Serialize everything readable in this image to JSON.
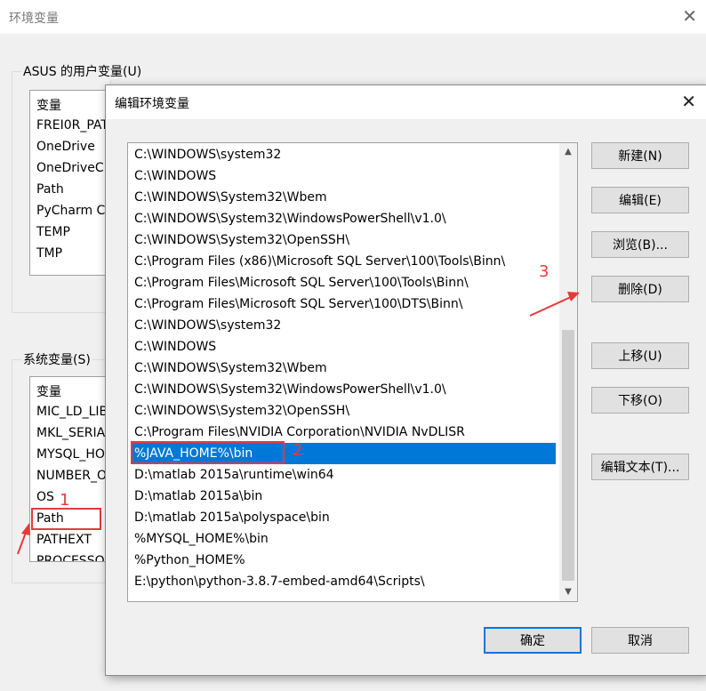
{
  "background_window": {
    "title": "环境变量",
    "user_vars": {
      "group_label": "ASUS 的用户变量(U)",
      "header": "变量",
      "items": [
        "FREI0R_PAT",
        "OneDrive",
        "OneDriveC",
        "Path",
        "PyCharm C",
        "TEMP",
        "TMP"
      ]
    },
    "system_vars": {
      "group_label": "系统变量(S)",
      "header": "变量",
      "items": [
        "MIC_LD_LIB",
        "MKL_SERIA",
        "MYSQL_HO",
        "NUMBER_O",
        "OS",
        "Path",
        "PATHEXT",
        "PROCESSO"
      ]
    }
  },
  "dialog": {
    "title": "编辑环境变量",
    "paths": [
      "C:\\WINDOWS\\system32",
      "C:\\WINDOWS",
      "C:\\WINDOWS\\System32\\Wbem",
      "C:\\WINDOWS\\System32\\WindowsPowerShell\\v1.0\\",
      "C:\\WINDOWS\\System32\\OpenSSH\\",
      "C:\\Program Files (x86)\\Microsoft SQL Server\\100\\Tools\\Binn\\",
      "C:\\Program Files\\Microsoft SQL Server\\100\\Tools\\Binn\\",
      "C:\\Program Files\\Microsoft SQL Server\\100\\DTS\\Binn\\",
      "C:\\WINDOWS\\system32",
      "C:\\WINDOWS",
      "C:\\WINDOWS\\System32\\Wbem",
      "C:\\WINDOWS\\System32\\WindowsPowerShell\\v1.0\\",
      "C:\\WINDOWS\\System32\\OpenSSH\\",
      "C:\\Program Files\\NVIDIA Corporation\\NVIDIA NvDLISR",
      "%JAVA_HOME%\\bin",
      "D:\\matlab 2015a\\runtime\\win64",
      "D:\\matlab 2015a\\bin",
      "D:\\matlab 2015a\\polyspace\\bin",
      "%MYSQL_HOME%\\bin",
      "%Python_HOME%",
      "E:\\python\\python-3.8.7-embed-amd64\\Scripts\\"
    ],
    "selected_index": 14,
    "buttons": {
      "new": "新建(N)",
      "edit": "编辑(E)",
      "browse": "浏览(B)...",
      "delete": "删除(D)",
      "move_up": "上移(U)",
      "move_down": "下移(O)",
      "edit_text": "编辑文本(T)...",
      "ok": "确定",
      "cancel": "取消"
    }
  },
  "annotations": {
    "step1": "1",
    "step2": "2",
    "step3": "3",
    "color": "#e8393a"
  },
  "colors": {
    "selection": "#0078d7",
    "button_face": "#e1e1e1",
    "window_bg": "#f0f0f0"
  },
  "icons": {
    "close": "close-icon",
    "scroll_up": "scroll-up-arrow-icon",
    "scroll_down": "scroll-down-arrow-icon"
  }
}
